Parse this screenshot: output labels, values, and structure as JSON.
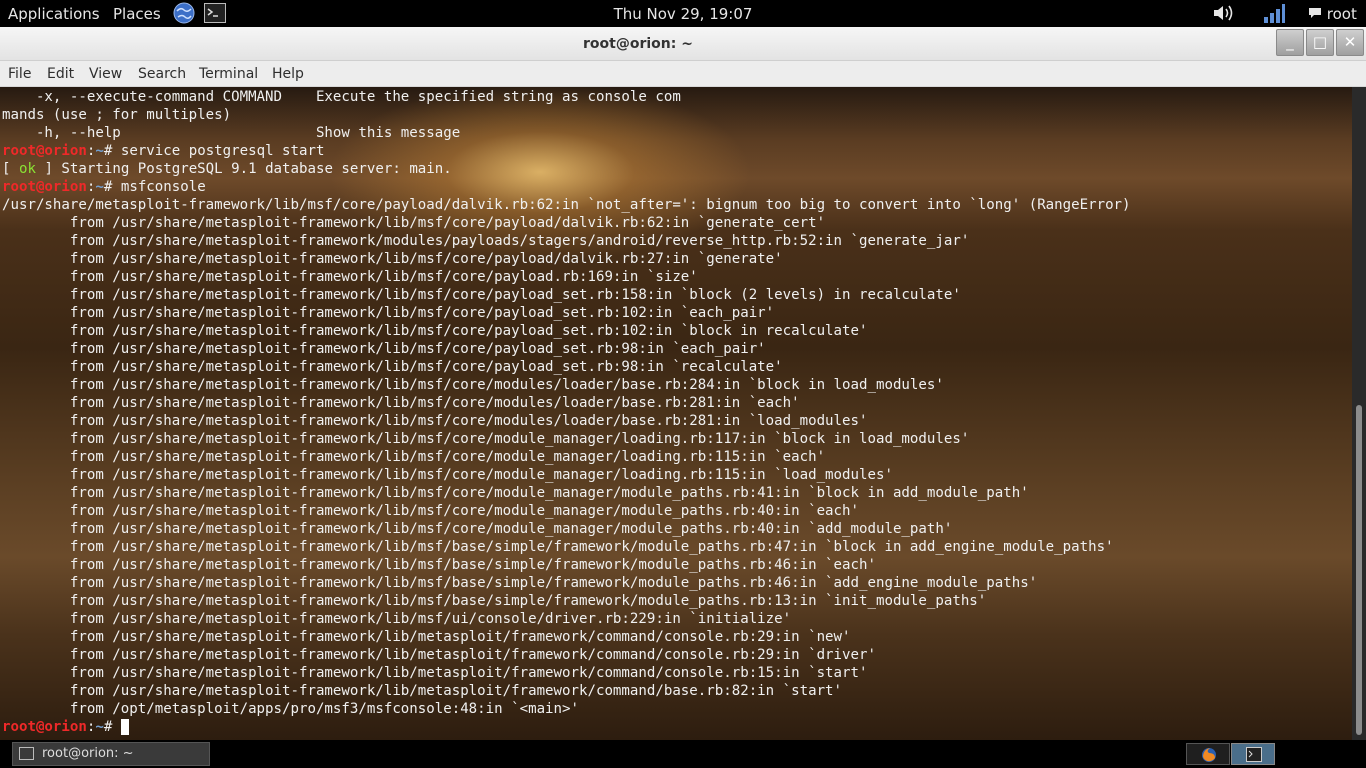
{
  "top_panel": {
    "applications": "Applications",
    "places": "Places",
    "clock": "Thu Nov 29, 19:07",
    "user": "root",
    "icons": [
      "web-browser-icon",
      "terminal-icon",
      "volume-icon",
      "network-icon",
      "chat-icon"
    ]
  },
  "window": {
    "title": "root@orion: ~",
    "minimize": "_",
    "maximize": "□",
    "close": "✕"
  },
  "menubar": {
    "file": "File",
    "edit": "Edit",
    "view": "View",
    "search": "Search",
    "terminal": "Terminal",
    "help": "Help"
  },
  "terminal": {
    "prompt_user": "root@orion",
    "prompt_sep": ":",
    "prompt_path": "~",
    "prompt_end": "# ",
    "lines": [
      {
        "type": "text",
        "text": "    -x, --execute-command COMMAND    Execute the specified string as console com"
      },
      {
        "type": "text",
        "text": "mands (use ; for multiples)"
      },
      {
        "type": "text",
        "text": "    -h, --help                       Show this message"
      },
      {
        "type": "prompt",
        "cmd": "service postgresql start"
      },
      {
        "type": "ok",
        "pre": "[ ",
        "ok": "ok",
        "post": " ] Starting PostgreSQL 9.1 database server: main."
      },
      {
        "type": "prompt",
        "cmd": "msfconsole"
      },
      {
        "type": "text",
        "text": "/usr/share/metasploit-framework/lib/msf/core/payload/dalvik.rb:62:in `not_after=': bignum too big to convert into `long' (RangeError)"
      },
      {
        "type": "text",
        "text": "        from /usr/share/metasploit-framework/lib/msf/core/payload/dalvik.rb:62:in `generate_cert'"
      },
      {
        "type": "text",
        "text": "        from /usr/share/metasploit-framework/modules/payloads/stagers/android/reverse_http.rb:52:in `generate_jar'"
      },
      {
        "type": "text",
        "text": "        from /usr/share/metasploit-framework/lib/msf/core/payload/dalvik.rb:27:in `generate'"
      },
      {
        "type": "text",
        "text": "        from /usr/share/metasploit-framework/lib/msf/core/payload.rb:169:in `size'"
      },
      {
        "type": "text",
        "text": "        from /usr/share/metasploit-framework/lib/msf/core/payload_set.rb:158:in `block (2 levels) in recalculate'"
      },
      {
        "type": "text",
        "text": "        from /usr/share/metasploit-framework/lib/msf/core/payload_set.rb:102:in `each_pair'"
      },
      {
        "type": "text",
        "text": "        from /usr/share/metasploit-framework/lib/msf/core/payload_set.rb:102:in `block in recalculate'"
      },
      {
        "type": "text",
        "text": "        from /usr/share/metasploit-framework/lib/msf/core/payload_set.rb:98:in `each_pair'"
      },
      {
        "type": "text",
        "text": "        from /usr/share/metasploit-framework/lib/msf/core/payload_set.rb:98:in `recalculate'"
      },
      {
        "type": "text",
        "text": "        from /usr/share/metasploit-framework/lib/msf/core/modules/loader/base.rb:284:in `block in load_modules'"
      },
      {
        "type": "text",
        "text": "        from /usr/share/metasploit-framework/lib/msf/core/modules/loader/base.rb:281:in `each'"
      },
      {
        "type": "text",
        "text": "        from /usr/share/metasploit-framework/lib/msf/core/modules/loader/base.rb:281:in `load_modules'"
      },
      {
        "type": "text",
        "text": "        from /usr/share/metasploit-framework/lib/msf/core/module_manager/loading.rb:117:in `block in load_modules'"
      },
      {
        "type": "text",
        "text": "        from /usr/share/metasploit-framework/lib/msf/core/module_manager/loading.rb:115:in `each'"
      },
      {
        "type": "text",
        "text": "        from /usr/share/metasploit-framework/lib/msf/core/module_manager/loading.rb:115:in `load_modules'"
      },
      {
        "type": "text",
        "text": "        from /usr/share/metasploit-framework/lib/msf/core/module_manager/module_paths.rb:41:in `block in add_module_path'"
      },
      {
        "type": "text",
        "text": "        from /usr/share/metasploit-framework/lib/msf/core/module_manager/module_paths.rb:40:in `each'"
      },
      {
        "type": "text",
        "text": "        from /usr/share/metasploit-framework/lib/msf/core/module_manager/module_paths.rb:40:in `add_module_path'"
      },
      {
        "type": "text",
        "text": "        from /usr/share/metasploit-framework/lib/msf/base/simple/framework/module_paths.rb:47:in `block in add_engine_module_paths'"
      },
      {
        "type": "text",
        "text": "        from /usr/share/metasploit-framework/lib/msf/base/simple/framework/module_paths.rb:46:in `each'"
      },
      {
        "type": "text",
        "text": "        from /usr/share/metasploit-framework/lib/msf/base/simple/framework/module_paths.rb:46:in `add_engine_module_paths'"
      },
      {
        "type": "text",
        "text": "        from /usr/share/metasploit-framework/lib/msf/base/simple/framework/module_paths.rb:13:in `init_module_paths'"
      },
      {
        "type": "text",
        "text": "        from /usr/share/metasploit-framework/lib/msf/ui/console/driver.rb:229:in `initialize'"
      },
      {
        "type": "text",
        "text": "        from /usr/share/metasploit-framework/lib/metasploit/framework/command/console.rb:29:in `new'"
      },
      {
        "type": "text",
        "text": "        from /usr/share/metasploit-framework/lib/metasploit/framework/command/console.rb:29:in `driver'"
      },
      {
        "type": "text",
        "text": "        from /usr/share/metasploit-framework/lib/metasploit/framework/command/console.rb:15:in `start'"
      },
      {
        "type": "text",
        "text": "        from /usr/share/metasploit-framework/lib/metasploit/framework/command/base.rb:82:in `start'"
      },
      {
        "type": "text",
        "text": "        from /opt/metasploit/apps/pro/msf3/msfconsole:48:in `<main>'"
      },
      {
        "type": "prompt",
        "cmd": "",
        "cursor": true
      }
    ]
  },
  "taskbar": {
    "task_label": "root@orion: ~",
    "workspaces": [
      "firefox-icon",
      "terminal-icon"
    ]
  }
}
